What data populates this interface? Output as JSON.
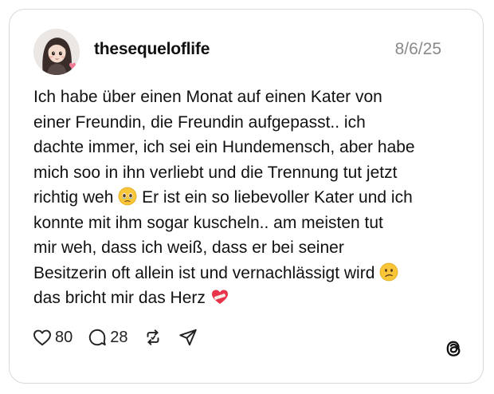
{
  "post": {
    "username": "thesequeloflife",
    "date": "8/6/25",
    "lines": [
      "Ich habe über einen Monat auf einen Kater von",
      "einer Freundin, die Freundin aufgepasst.. ich",
      "dachte immer, ich sei ein Hundemensch, aber habe",
      "mich soo in ihn verliebt und die Trennung tut jetzt"
    ],
    "line5_before": "richtig weh",
    "line5_after": "Er ist ein so liebevoller Kater und ich",
    "lines_mid": [
      "konnte mit ihm sogar kuscheln.. am meisten tut",
      "mir weh, dass ich weiß, dass er bei seiner"
    ],
    "line8": "Besitzerin oft allein ist und vernachlässigt wird",
    "line9": "das bricht mir das Herz"
  },
  "emojis": {
    "holding_tears": "face-holding-back-tears-emoji",
    "confused": "confused-face-emoji",
    "heart": "mending-heart-emoji"
  },
  "actions": {
    "likes": "80",
    "replies": "28"
  },
  "icons": {
    "like": "heart-icon",
    "reply": "speech-bubble-icon",
    "repost": "repost-icon",
    "share": "send-icon",
    "brand": "threads-logo"
  },
  "colors": {
    "border": "#d9d9d9",
    "text": "#111111",
    "muted": "#8a8a8a"
  }
}
